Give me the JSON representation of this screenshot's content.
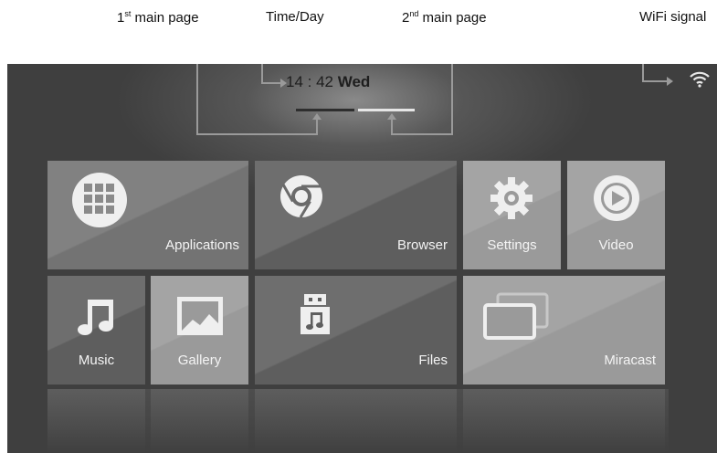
{
  "callouts": {
    "first_main_page": {
      "num": "1",
      "sup": "st",
      "text": " main page"
    },
    "time_day": "Time/Day",
    "second_main_page": {
      "num": "2",
      "sup": "nd",
      "text": " main page"
    },
    "wifi_signal": "WiFi signal"
  },
  "status": {
    "time": "14 : 42",
    "day": "Wed",
    "wifi_icon": "wifi-icon"
  },
  "pages": {
    "count": 2,
    "active": 2
  },
  "tiles": {
    "applications": {
      "label": "Applications",
      "icon": "grid-icon"
    },
    "browser": {
      "label": "Browser",
      "icon": "chrome-icon"
    },
    "settings": {
      "label": "Settings",
      "icon": "gear-icon"
    },
    "video": {
      "label": "Video",
      "icon": "play-icon"
    },
    "music": {
      "label": "Music",
      "icon": "music-note-icon"
    },
    "gallery": {
      "label": "Gallery",
      "icon": "picture-icon"
    },
    "files": {
      "label": "Files",
      "icon": "usb-music-icon"
    },
    "miracast": {
      "label": "Miracast",
      "icon": "miracast-icon"
    }
  },
  "colors": {
    "tile_dark": "#5e5e5e",
    "tile_mid": "#737373",
    "tile_light": "#9a9a9a",
    "label": "#f4f4f4"
  }
}
